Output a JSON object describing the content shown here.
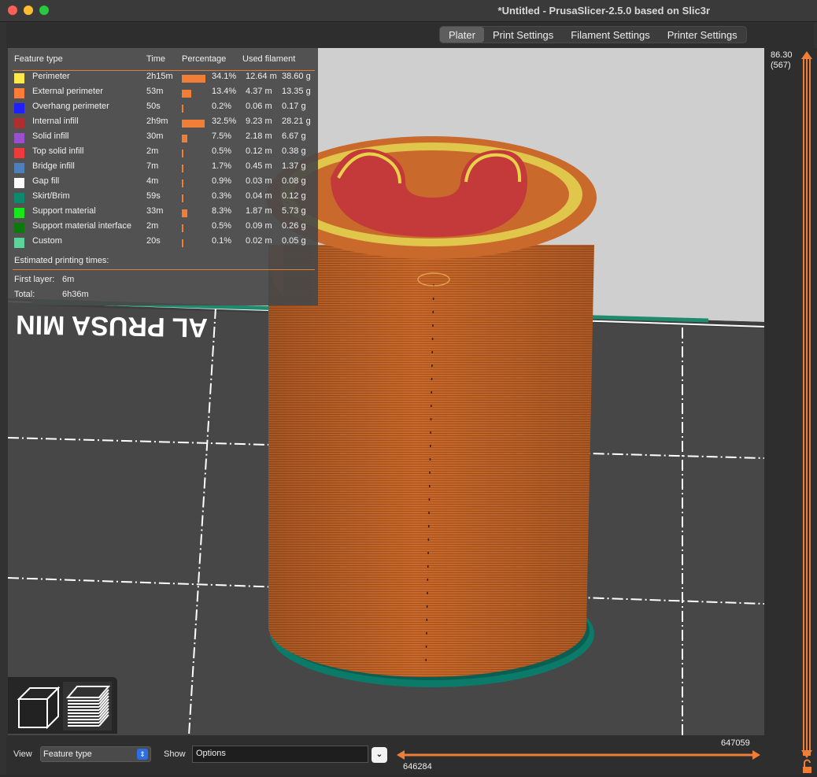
{
  "window": {
    "title": "*Untitled - PrusaSlicer-2.5.0 based on Slic3r"
  },
  "tabs": [
    {
      "label": "Plater",
      "active": true
    },
    {
      "label": "Print Settings",
      "active": false
    },
    {
      "label": "Filament Settings",
      "active": false
    },
    {
      "label": "Printer Settings",
      "active": false
    }
  ],
  "legend": {
    "headers": {
      "feature_type": "Feature type",
      "time": "Time",
      "percentage": "Percentage",
      "used_filament": "Used filament"
    },
    "rows": [
      {
        "name": "Perimeter",
        "color": "#ffe84a",
        "time": "2h15m",
        "percent": "34.1%",
        "fraction": 0.341,
        "length": "12.64 m",
        "weight": "38.60 g"
      },
      {
        "name": "External perimeter",
        "color": "#ff7c38",
        "time": "53m",
        "percent": "13.4%",
        "fraction": 0.134,
        "length": "4.37 m",
        "weight": "13.35 g"
      },
      {
        "name": "Overhang perimeter",
        "color": "#1f1fff",
        "time": "50s",
        "percent": "0.2%",
        "fraction": 0.002,
        "length": "0.06 m",
        "weight": "0.17 g"
      },
      {
        "name": "Internal infill",
        "color": "#b02e2e",
        "time": "2h9m",
        "percent": "32.5%",
        "fraction": 0.325,
        "length": "9.23 m",
        "weight": "28.21 g"
      },
      {
        "name": "Solid infill",
        "color": "#9a4fcf",
        "time": "30m",
        "percent": "7.5%",
        "fraction": 0.075,
        "length": "2.18 m",
        "weight": "6.67 g"
      },
      {
        "name": "Top solid infill",
        "color": "#f03a3a",
        "time": "2m",
        "percent": "0.5%",
        "fraction": 0.005,
        "length": "0.12 m",
        "weight": "0.38 g"
      },
      {
        "name": "Bridge infill",
        "color": "#4d80ba",
        "time": "7m",
        "percent": "1.7%",
        "fraction": 0.017,
        "length": "0.45 m",
        "weight": "1.37 g"
      },
      {
        "name": "Gap fill",
        "color": "#ffffff",
        "time": "4m",
        "percent": "0.9%",
        "fraction": 0.009,
        "length": "0.03 m",
        "weight": "0.08 g"
      },
      {
        "name": "Skirt/Brim",
        "color": "#0b8a6f",
        "time": "59s",
        "percent": "0.3%",
        "fraction": 0.003,
        "length": "0.04 m",
        "weight": "0.12 g"
      },
      {
        "name": "Support material",
        "color": "#17e81a",
        "time": "33m",
        "percent": "8.3%",
        "fraction": 0.083,
        "length": "1.87 m",
        "weight": "5.73 g"
      },
      {
        "name": "Support material interface",
        "color": "#0b7a0b",
        "time": "2m",
        "percent": "0.5%",
        "fraction": 0.005,
        "length": "0.09 m",
        "weight": "0.26 g"
      },
      {
        "name": "Custom",
        "color": "#5cd49a",
        "time": "20s",
        "percent": "0.1%",
        "fraction": 0.001,
        "length": "0.02 m",
        "weight": "0.05 g"
      }
    ],
    "estimated_title": "Estimated printing times:",
    "first_layer_label": "First layer:",
    "first_layer_value": "6m",
    "total_label": "Total:",
    "total_value": "6h36m"
  },
  "scene": {
    "bed_text": "AL PRUSA MIN",
    "colors": {
      "body": "#c9692b",
      "body_dark": "#a9531f",
      "top_infill": "#c43a3a",
      "perimeter": "#e8d24a",
      "brim": "#0b7a68",
      "bed": "#4a4a4a"
    }
  },
  "bottom": {
    "view_label": "View",
    "view_value": "Feature type",
    "show_label": "Show",
    "show_value": "Options",
    "slider_min": "646284",
    "slider_max": "647059"
  },
  "vertical_slider": {
    "height": "86.30",
    "layer": "(567)"
  },
  "accent": "#f17e36"
}
